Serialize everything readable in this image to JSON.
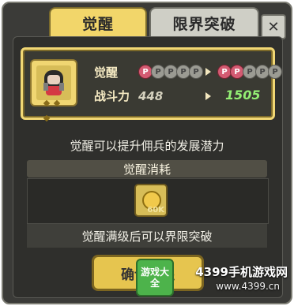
{
  "tabs": {
    "active_label": "觉醒",
    "inactive_label": "限界突破"
  },
  "close_label": "✕",
  "stats": {
    "awakening_label": "觉醒",
    "power_label": "战斗力",
    "power_old": "448",
    "power_new": "1505",
    "star_old_letters": [
      "P",
      "P",
      "P",
      "P",
      "P"
    ],
    "star_new_letters": [
      "P",
      "P",
      "P",
      "P",
      "P"
    ]
  },
  "description": "觉醒可以提升佣兵的发展潜力",
  "cost": {
    "header": "觉醒消耗",
    "item_qty": "60K"
  },
  "bottom_note": "觉醒满级后可以界限突破",
  "confirm_label": "确认觉醒",
  "watermark": {
    "site_text": "4399手机游戏网",
    "url_text": "www.4399.cn",
    "logo_text": "游戏大全"
  },
  "colors": {
    "accent": "#f2d66a",
    "on_pill": "#d35b72",
    "new_value": "#93ef74"
  }
}
